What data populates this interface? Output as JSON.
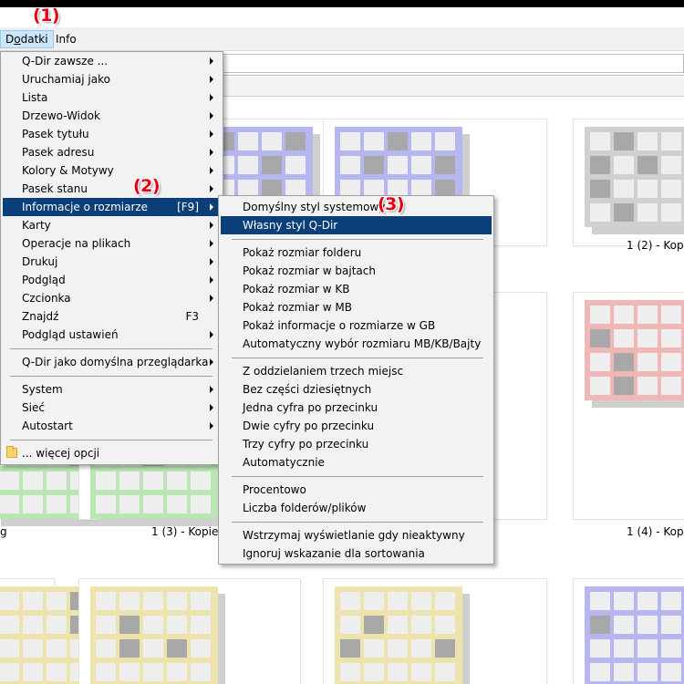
{
  "annotations": [
    "(1)",
    "(2)",
    "(3)"
  ],
  "menubar": {
    "dodatki": "Dodatki",
    "info": "Info"
  },
  "menu1": {
    "items": [
      {
        "label": "Q-Dir zawsze ...",
        "submenu": true
      },
      {
        "label": "Uruchamiaj jako",
        "submenu": true
      },
      {
        "label": "Lista",
        "submenu": true
      },
      {
        "label": "Drzewo-Widok",
        "submenu": true
      },
      {
        "label": "Pasek tytułu",
        "submenu": true
      },
      {
        "label": "Pasek adresu",
        "submenu": true
      },
      {
        "label": "Kolory & Motywy",
        "submenu": true
      },
      {
        "label": "Pasek stanu",
        "submenu": true
      },
      {
        "label": "Informacje o rozmiarze",
        "shortcut": "[F9]",
        "submenu": true,
        "highlighted": true
      },
      {
        "label": "Karty",
        "submenu": true
      },
      {
        "label": "Operacje na plikach",
        "submenu": true
      },
      {
        "label": "Drukuj",
        "submenu": true
      },
      {
        "label": "Podgląd",
        "submenu": true
      },
      {
        "label": "Czcionka",
        "submenu": true
      },
      {
        "label": "Znajdź",
        "shortcut": "F3",
        "submenu": false
      },
      {
        "label": "Podgląd ustawień",
        "submenu": true
      },
      {
        "label": "Q-Dir jako domyślna przeglądarka",
        "submenu": true
      },
      {
        "label": "System",
        "submenu": true
      },
      {
        "label": "Sieć",
        "submenu": true
      },
      {
        "label": "Autostart",
        "submenu": true
      },
      {
        "label": "... więcej opcji",
        "icon": "folder-icon"
      }
    ]
  },
  "menu2": {
    "items": [
      {
        "label": "Domyślny styl systemowy"
      },
      {
        "label": "Własny styl Q-Dir",
        "highlighted": true
      },
      {
        "label": "Pokaż rozmiar folderu"
      },
      {
        "label": "Pokaż rozmiar w bajtach"
      },
      {
        "label": "Pokaż rozmiar w KB"
      },
      {
        "label": "Pokaż rozmiar w MB"
      },
      {
        "label": "Pokaż informacje o rozmiarze w GB"
      },
      {
        "label": "Automatyczny wybór rozmiaru MB/KB/Bajty"
      },
      {
        "label": "Z oddzielaniem trzech miejsc"
      },
      {
        "label": "Bez części dziesiętnych"
      },
      {
        "label": "Jedna cyfra po przecinku"
      },
      {
        "label": "Dwie cyfry po przecinku"
      },
      {
        "label": "Trzy cyfry po przecinku"
      },
      {
        "label": "Automatycznie"
      },
      {
        "label": "Procentowo"
      },
      {
        "label": "Liczba folderów/plików"
      },
      {
        "label": "Wstrzymaj wyświetlanie gdy nieaktywny"
      },
      {
        "label": "Ignoruj wskazanie dla sortowania"
      }
    ]
  },
  "files": {
    "captions": [
      "1 (2) - Kopie",
      "g",
      "1 (3) - Kopie.p",
      "1 (4) - Kopie"
    ]
  },
  "colors": {
    "blue": "#b6b6f0",
    "grey": "#d0d0d0",
    "green": "#b9e6b2",
    "red": "#f0b7b7",
    "yellow": "#ede3ad",
    "menu_highlight": "#0a3f79"
  }
}
